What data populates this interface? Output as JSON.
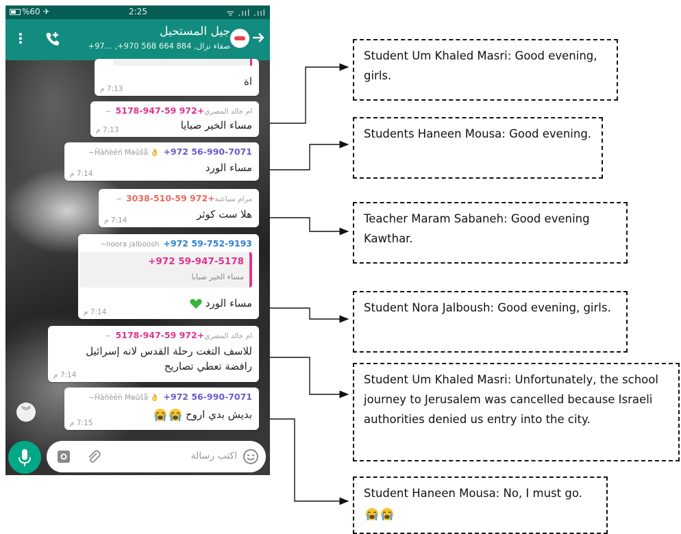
{
  "status_bar": {
    "left": "%60 ✈",
    "time": "2:25",
    "right": "ᯤ .ııl .ııl"
  },
  "header": {
    "title": "جيل المستحيل",
    "subtitle": "صفاء نزال, 884 664 568 970+, ...97+"
  },
  "messages": [
    {
      "text": "اة",
      "time": "7:13 م",
      "top_fragment": "..."
    },
    {
      "phone": "+972 59-947-5178",
      "nick": "~ام خالد المصري",
      "text": "مساء الخير صبايا",
      "time": "7:13 م",
      "color": "#e0338b"
    },
    {
      "phone": "+972 56-990-7071",
      "nick": "~Ĥàňèéń Mөûŝå 👌",
      "text": "مساء الورد",
      "time": "7:14 م",
      "color": "#6a5acd"
    },
    {
      "phone": "+972 59-510-3038",
      "nick": "~مرام سباعنة",
      "text": "هلا ست كوثر",
      "time": "7:14 م",
      "color": "#e86a5a"
    },
    {
      "phone": "+972 59-752-9193",
      "nick": "~noora jalboosh",
      "quote_phone": "+972 59-947-5178",
      "quote_text": "مساء الخير صبايا",
      "text": "مساء الورد",
      "time": "7:14 م",
      "color": "#2d7fd3"
    },
    {
      "phone": "+972 59-947-5178",
      "nick": "~ام خالد المصري",
      "text_line1": "للاسف التغت رحلة القدس لانه إسرائيل",
      "text_line2": "رافضة تعطي تصاريح",
      "time": "7:14 م",
      "color": "#e0338b"
    },
    {
      "phone": "+972 56-990-7071",
      "nick": "~Ĥàňèéń Mөûŝå 👌",
      "text": "بديش بدي اروح",
      "time": "7:15 م",
      "color": "#6a5acd"
    }
  ],
  "composer": {
    "placeholder": "اكتب رسالة"
  },
  "translations": [
    "Student Um Khaled Masri: Good evening, girls.",
    "Students Haneen Mousa: Good evening.",
    "Teacher Maram Sabaneh: Good evening Kawthar.",
    "Student Nora Jalboush: Good evening, girls.",
    "Student Um Khaled Masri: Unfortunately, the school journey to Jerusalem was cancelled because Israeli authorities denied us entry into the city.",
    "Student Haneen Mousa: No, I must go."
  ],
  "colors": {
    "appbar": "#128c7e",
    "statusbar": "#075e54",
    "mic": "#00a884"
  },
  "icons": [
    "menu-icon",
    "add-call-icon",
    "back-arrow-icon",
    "heart-icon",
    "crying-emoji-icon",
    "camera-icon",
    "attach-icon",
    "emoji-icon",
    "mic-icon",
    "scroll-down-icon"
  ]
}
